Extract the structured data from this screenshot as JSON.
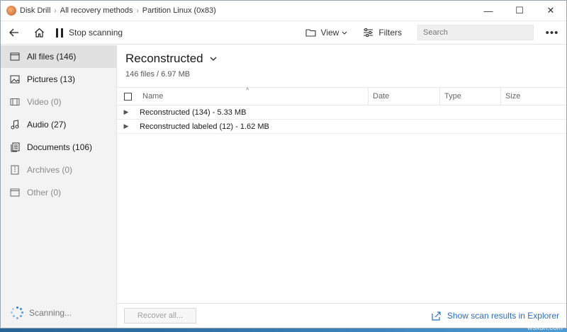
{
  "titlebar": {
    "app_name": "Disk Drill",
    "crumbs": [
      "All recovery methods",
      "Partition Linux (0x83)"
    ],
    "minimize": "—",
    "maximize": "☐",
    "close": "✕"
  },
  "toolbar": {
    "stop_label": "Stop scanning",
    "view_label": "View",
    "filters_label": "Filters",
    "search_placeholder": "Search",
    "more": "•••"
  },
  "sidebar": {
    "items": [
      {
        "label": "All files (146)",
        "icon": "all-files-icon"
      },
      {
        "label": "Pictures (13)",
        "icon": "pictures-icon"
      },
      {
        "label": "Video (0)",
        "icon": "video-icon"
      },
      {
        "label": "Audio (27)",
        "icon": "audio-icon"
      },
      {
        "label": "Documents (106)",
        "icon": "documents-icon"
      },
      {
        "label": "Archives (0)",
        "icon": "archives-icon"
      },
      {
        "label": "Other (0)",
        "icon": "other-icon"
      }
    ],
    "scanning_label": "Scanning..."
  },
  "main": {
    "title": "Reconstructed",
    "summary": "146 files / 6.97 MB",
    "columns": [
      "Name",
      "Date",
      "Type",
      "Size"
    ],
    "rows": [
      {
        "label": "Reconstructed (134) - 5.33 MB"
      },
      {
        "label": "Reconstructed labeled (12) - 1.62 MB"
      }
    ]
  },
  "footer": {
    "recover_label": "Recover all...",
    "explorer_label": "Show scan results in Explorer"
  },
  "watermark": "wsxdn.com",
  "colors": {
    "accent": "#2a6fbf",
    "sidebar_bg": "#f3f3f3",
    "active_bg": "#e1e1e1"
  }
}
